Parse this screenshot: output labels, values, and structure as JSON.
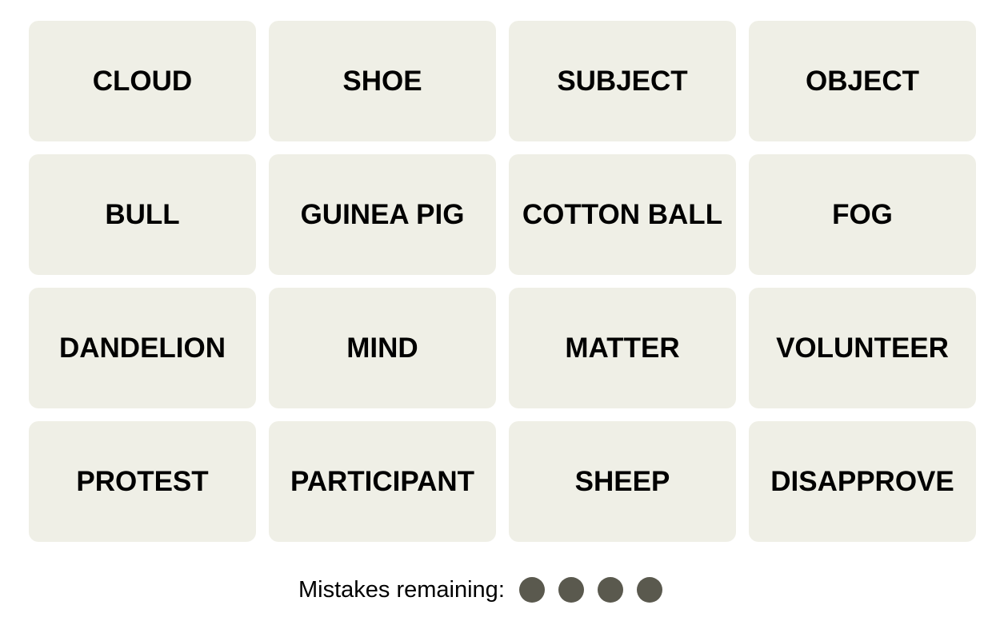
{
  "board": {
    "tiles": [
      "CLOUD",
      "SHOE",
      "SUBJECT",
      "OBJECT",
      "BULL",
      "GUINEA PIG",
      "COTTON BALL",
      "FOG",
      "DANDELION",
      "MIND",
      "MATTER",
      "VOLUNTEER",
      "PROTEST",
      "PARTICIPANT",
      "SHEEP",
      "DISAPPROVE"
    ]
  },
  "mistakes": {
    "label": "Mistakes remaining:",
    "remaining": 4,
    "dot_color": "#5a594e"
  },
  "colors": {
    "tile_background": "#efefe6",
    "text": "#000000"
  }
}
